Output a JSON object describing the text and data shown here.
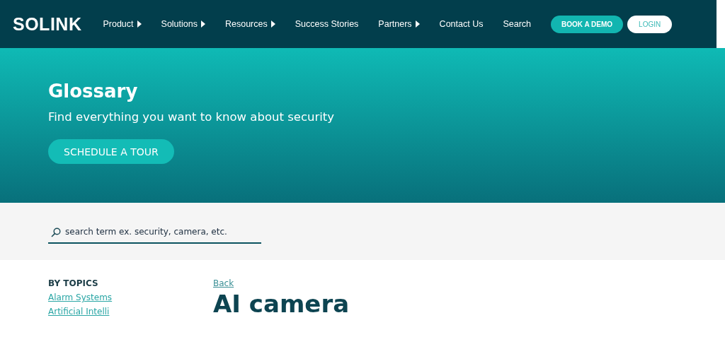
{
  "header": {
    "logo": "SOLINK",
    "nav": [
      {
        "label": "Product",
        "has_menu": true
      },
      {
        "label": "Solutions",
        "has_menu": true
      },
      {
        "label": "Resources",
        "has_menu": true
      },
      {
        "label": "Success Stories",
        "has_menu": false
      },
      {
        "label": "Partners",
        "has_menu": true
      },
      {
        "label": "Contact Us",
        "has_menu": false
      },
      {
        "label": "Search",
        "has_menu": false
      }
    ],
    "demo_button": "BOOK A DEMO",
    "login_button": "LOGIN"
  },
  "hero": {
    "title": "Glossary",
    "subtitle": "Find everything you want to know about security",
    "button": "SCHEDULE A TOUR"
  },
  "search": {
    "placeholder": "search term ex. security, camera, etc."
  },
  "sidebar": {
    "heading": "BY TOPICS",
    "links": [
      "Alarm Systems",
      "Artificial Intelli"
    ]
  },
  "article": {
    "back_link": "Back",
    "title": "AI camera"
  }
}
